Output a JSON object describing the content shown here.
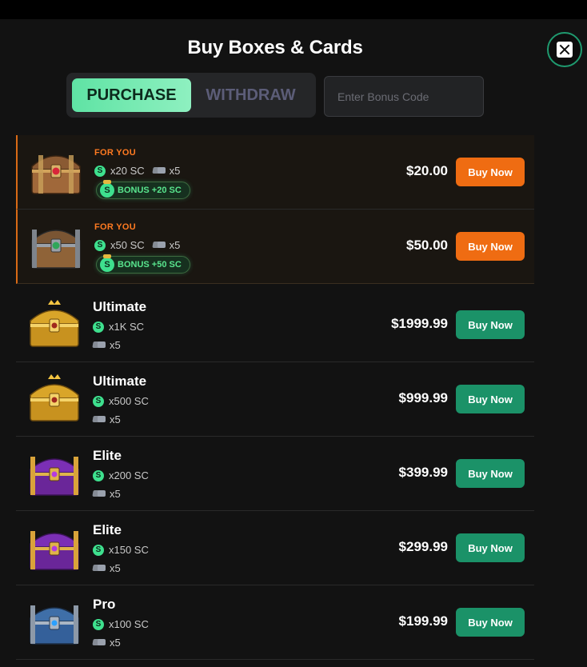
{
  "header": {
    "title": "Buy Boxes & Cards"
  },
  "tabs": [
    {
      "label": "PURCHASE",
      "active": true
    },
    {
      "label": "WITHDRAW",
      "active": false
    }
  ],
  "bonus": {
    "placeholder": "Enter Bonus Code"
  },
  "featured": [
    {
      "tag": "FOR YOU",
      "sc": "x20 SC",
      "cards": "x5",
      "bonus": "BONUS +20 SC",
      "price": "$20.00",
      "button": "Buy Now",
      "chest": "wood-red"
    },
    {
      "tag": "FOR YOU",
      "sc": "x50 SC",
      "cards": "x5",
      "bonus": "BONUS +50 SC",
      "price": "$50.00",
      "button": "Buy Now",
      "chest": "wood-steel"
    }
  ],
  "items": [
    {
      "name": "Ultimate",
      "sc": "x1K SC",
      "cards": "x5",
      "price": "$1999.99",
      "button": "Buy Now",
      "chest": "gold"
    },
    {
      "name": "Ultimate",
      "sc": "x500 SC",
      "cards": "x5",
      "price": "$999.99",
      "button": "Buy Now",
      "chest": "gold"
    },
    {
      "name": "Elite",
      "sc": "x200 SC",
      "cards": "x5",
      "price": "$399.99",
      "button": "Buy Now",
      "chest": "purple"
    },
    {
      "name": "Elite",
      "sc": "x150 SC",
      "cards": "x5",
      "price": "$299.99",
      "button": "Buy Now",
      "chest": "purple"
    },
    {
      "name": "Pro",
      "sc": "x100 SC",
      "cards": "x5",
      "price": "$199.99",
      "button": "Buy Now",
      "chest": "blue"
    }
  ],
  "colors": {
    "accent_green": "#1b9268",
    "accent_orange": "#ef6c12",
    "tab_active": "#6ee7ad",
    "coin": "#3ee08e"
  }
}
